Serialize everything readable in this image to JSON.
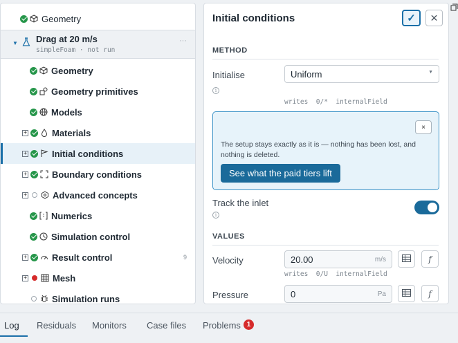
{
  "tree": {
    "top_item": "Geometry",
    "case": {
      "name": "Drag at 20 m/s",
      "subtitle": "simpleFoam · not run",
      "more": "···"
    },
    "items": [
      {
        "label": "Geometry"
      },
      {
        "label": "Geometry primitives"
      },
      {
        "label": "Models"
      },
      {
        "label": "Materials"
      },
      {
        "label": "Initial conditions"
      },
      {
        "label": "Boundary conditions"
      },
      {
        "label": "Advanced concepts"
      },
      {
        "label": "Numerics"
      },
      {
        "label": "Simulation control"
      },
      {
        "label": "Result control",
        "count": "9"
      },
      {
        "label": "Mesh"
      },
      {
        "label": "Simulation runs"
      }
    ]
  },
  "panel": {
    "title": "Initial conditions",
    "method_header": "METHOD",
    "initialise_label": "Initialise",
    "initialise_value": "Uniform",
    "initialise_writes": "writes  0/*  internalField",
    "notice": {
      "message": "The setup stays exactly as it is — nothing has been lost, and nothing is deleted.",
      "button": "See what the paid tiers lift",
      "close": "×"
    },
    "track_inlet_label": "Track the inlet",
    "track_inlet_on": true,
    "values_header": "VALUES",
    "velocity": {
      "label": "Velocity",
      "value": "20.00",
      "unit": "m/s",
      "writes": "writes  0/U  internalField"
    },
    "pressure": {
      "label": "Pressure",
      "value": "0",
      "unit": "Pa"
    }
  },
  "bottom_tabs": {
    "log": "Log",
    "residuals": "Residuals",
    "monitors": "Monitors",
    "case_files": "Case files",
    "problems": "Problems",
    "problems_count": "1"
  },
  "colors": {
    "accent": "#1a6fa8",
    "ok": "#26964a",
    "error": "#d62b2b",
    "notice_bg": "#e7f3fa"
  }
}
